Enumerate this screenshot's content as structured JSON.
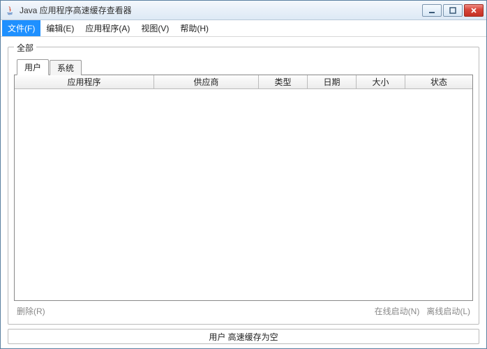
{
  "window": {
    "title": "Java 应用程序高速缓存查看器"
  },
  "menu": {
    "file": "文件(F)",
    "edit": "编辑(E)",
    "application": "应用程序(A)",
    "view": "视图(V)",
    "help": "帮助(H)"
  },
  "group": {
    "label": "全部"
  },
  "tabs": {
    "user": "用户",
    "system": "系统"
  },
  "columns": {
    "application": "应用程序",
    "vendor": "供应商",
    "type": "类型",
    "date": "日期",
    "size": "大小",
    "state": "状态"
  },
  "footer": {
    "delete": "删除(R)",
    "online": "在线启动(N)",
    "offline": "离线启动(L)"
  },
  "status": {
    "message": "用户 高速缓存为空"
  }
}
